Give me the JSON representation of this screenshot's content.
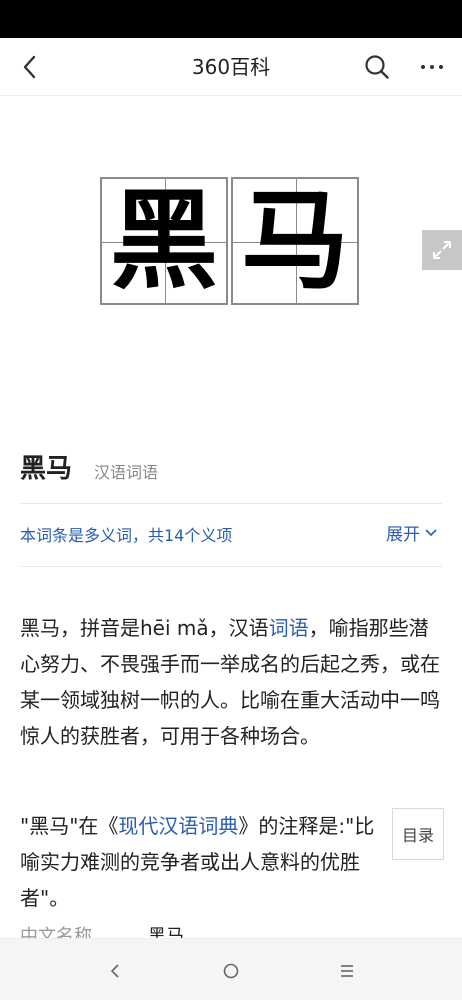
{
  "header": {
    "back_icon": "back-chevron-icon",
    "title": "360百科",
    "search_icon": "search-icon",
    "more_icon": "more-dots-icon"
  },
  "hero": {
    "characters": [
      "黑",
      "马"
    ],
    "expand_icon": "fullscreen-expand-icon"
  },
  "entry": {
    "title": "黑马",
    "subtitle": "汉语词语"
  },
  "polysemy": {
    "text": "本词条是多义词，共14个义项",
    "expand_label": "展开"
  },
  "content": {
    "para1_before": "黑马，拼音是hēi mǎ，汉语",
    "para1_link": "词语",
    "para1_after": "，喻指那些潜心努力、不畏强手而一举成名的后起之秀，或在某一领域独树一帜的人。比喻在重大活动中一鸣惊人的获胜者，可用于各种场合。",
    "para2_before": "\"黑马\"在《",
    "para2_link": "现代汉语词典",
    "para2_after": "》的注释是:\"比喻实力难测的竞争者或出人意料的优胜者\"。"
  },
  "toc": {
    "label": "目录"
  },
  "info": {
    "label": "中文名称",
    "value": "黑马"
  },
  "colors": {
    "link": "#2a5db0",
    "status_bar": "#000000"
  },
  "nav": {
    "back_icon": "nav-back-icon",
    "home_icon": "nav-home-icon",
    "menu_icon": "nav-menu-icon"
  }
}
